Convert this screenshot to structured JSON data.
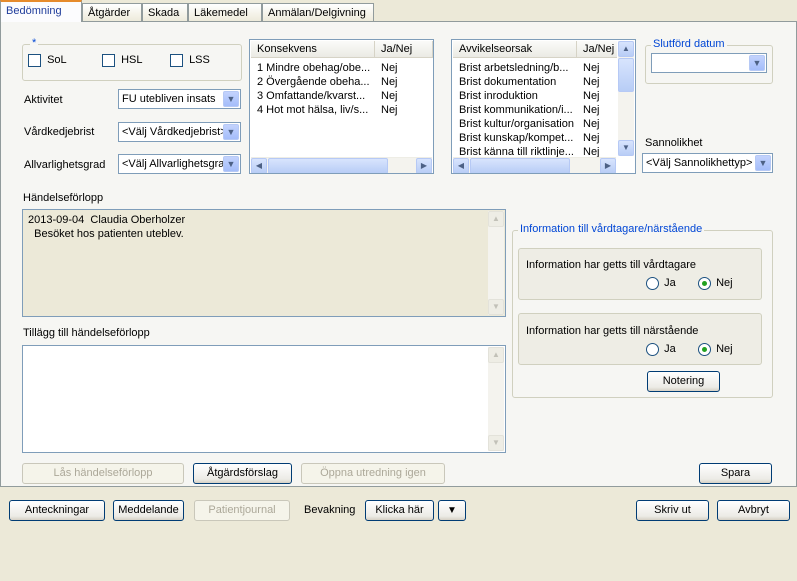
{
  "tabs": [
    {
      "label": "Bedömning",
      "active": true
    },
    {
      "label": "Åtgärder"
    },
    {
      "label": "Skada"
    },
    {
      "label": "Läkemedel"
    },
    {
      "label": "Anmälan/Delgivning"
    }
  ],
  "required_marker": "*",
  "law": {
    "sol": "SoL",
    "hsl": "HSL",
    "lss": "LSS"
  },
  "aktivitet": {
    "label": "Aktivitet",
    "value": "FU utebliven insats"
  },
  "vardkedjebrist": {
    "label": "Vårdkedjebrist",
    "value": "<Välj Vårdkedjebrist>"
  },
  "allvarlighetsgrad": {
    "label": "Allvarlighetsgrad",
    "value": "<Välj Allvarlighetsgrad>"
  },
  "konsekvens": {
    "headers": [
      "Konsekvens",
      "Ja/Nej"
    ],
    "rows": [
      [
        "1 Mindre obehag/obe...",
        "Nej"
      ],
      [
        "2 Övergående obeha...",
        "Nej"
      ],
      [
        "3 Omfattande/kvarst...",
        "Nej"
      ],
      [
        "4 Hot mot hälsa, liv/s...",
        "Nej"
      ]
    ]
  },
  "avvikelseorsak": {
    "headers": [
      "Avvikelseorsak",
      "Ja/Nej"
    ],
    "rows": [
      [
        "Brist arbetsledning/b...",
        "Nej"
      ],
      [
        "Brist dokumentation",
        "Nej"
      ],
      [
        "Brist inroduktion",
        "Nej"
      ],
      [
        "Brist kommunikation/i...",
        "Nej"
      ],
      [
        "Brist kultur/organisation",
        "Nej"
      ],
      [
        "Brist kunskap/kompet...",
        "Nej"
      ],
      [
        "Brist känna till riktlinje...",
        "Nej"
      ]
    ]
  },
  "slutford_datum": {
    "label": "Slutförd datum",
    "value": ""
  },
  "sannolikhet": {
    "label": "Sannolikhet",
    "value": "<Välj Sannolikhettyp>"
  },
  "handelseforlopp": {
    "label": "Händelseförlopp",
    "line1": "2013-09-04  Claudia Oberholzer",
    "line2": "  Besöket hos patienten uteblev."
  },
  "tillagg": {
    "label": "Tillägg till händelseförlopp",
    "value": ""
  },
  "info_group": {
    "title": "Information till vårdtagare/närstående",
    "vardtagare": {
      "label": "Information har getts till vårdtagare",
      "ja": "Ja",
      "nej": "Nej",
      "selected": "Nej"
    },
    "narstaende": {
      "label": "Information har getts till närstående",
      "ja": "Ja",
      "nej": "Nej",
      "selected": "Nej"
    },
    "notering_button": "Notering"
  },
  "buttons": {
    "las": "Lås händelseförlopp",
    "atgardsforslag": "Åtgärdsförslag",
    "oppna": "Öppna utredning igen",
    "spara": "Spara"
  },
  "bottom": {
    "anteckningar": "Anteckningar",
    "meddelande": "Meddelande",
    "patientjournal": "Patientjournal",
    "bevakning_label": "Bevakning",
    "klicka": "Klicka här",
    "skriv_ut": "Skriv ut",
    "avbryt": "Avbryt"
  },
  "colors": {
    "accent": "#0046d5",
    "background": "#ece9d8",
    "tab_highlight": "#e68b2c"
  }
}
